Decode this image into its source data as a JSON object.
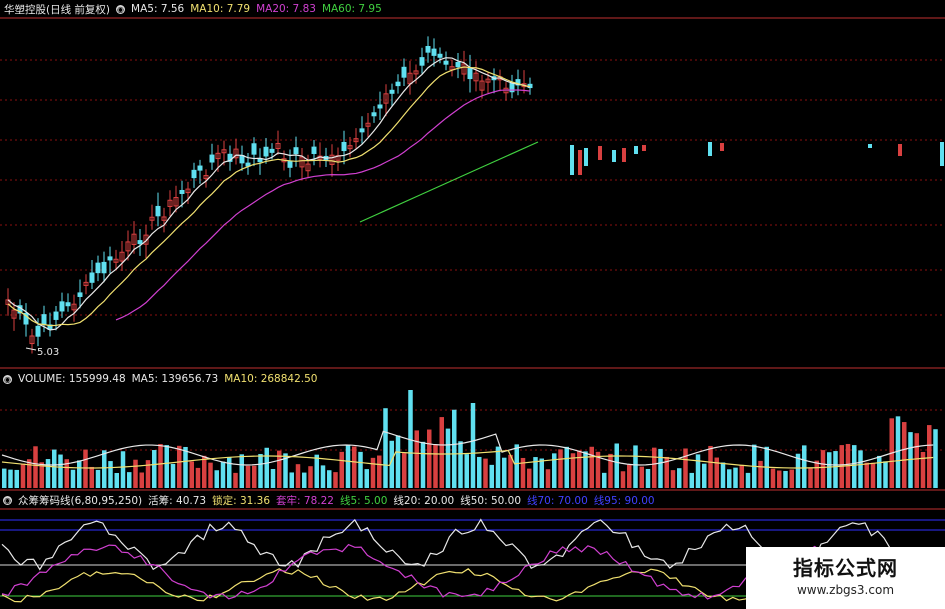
{
  "main_panel": {
    "stock_name": "华塑控股(日线 前复权)",
    "ma_items": [
      {
        "text": "MA5: 7.56",
        "color": "#e8e8e8"
      },
      {
        "text": "MA10: 7.79",
        "color": "#f0e070"
      },
      {
        "text": "MA20: 7.83",
        "color": "#d040d0"
      },
      {
        "text": "MA60: 7.95",
        "color": "#40d040"
      }
    ],
    "low_label": "5.03"
  },
  "volume_panel": {
    "title": "VOLUME: 155999.48",
    "ma_items": [
      {
        "text": "MA5: 139656.73",
        "color": "#e8e8e8"
      },
      {
        "text": "MA10: 268842.50",
        "color": "#f0e070"
      }
    ]
  },
  "indicator_panel": {
    "title": "众筹筹码线(6,80,95,250)",
    "items": [
      {
        "text": "活筹: 40.73",
        "color": "#e8e8e8"
      },
      {
        "text": "锁定: 31.36",
        "color": "#f0e070"
      },
      {
        "text": "套牢: 78.22",
        "color": "#d040d0"
      },
      {
        "text": "线5: 5.00",
        "color": "#40d040"
      },
      {
        "text": "线20: 20.00",
        "color": "#e8e8e8"
      },
      {
        "text": "线50: 50.00",
        "color": "#e8e8e8"
      },
      {
        "text": "线70: 70.00",
        "color": "#4040ff"
      },
      {
        "text": "线95: 90.00",
        "color": "#4040ff"
      }
    ]
  },
  "watermark": {
    "title": "指标公式网",
    "url": "www.zbgs3.com"
  },
  "colors": {
    "up": "#d84040",
    "down": "#60e0f0",
    "grid": "#8a1010",
    "divider": "#c03030"
  }
}
